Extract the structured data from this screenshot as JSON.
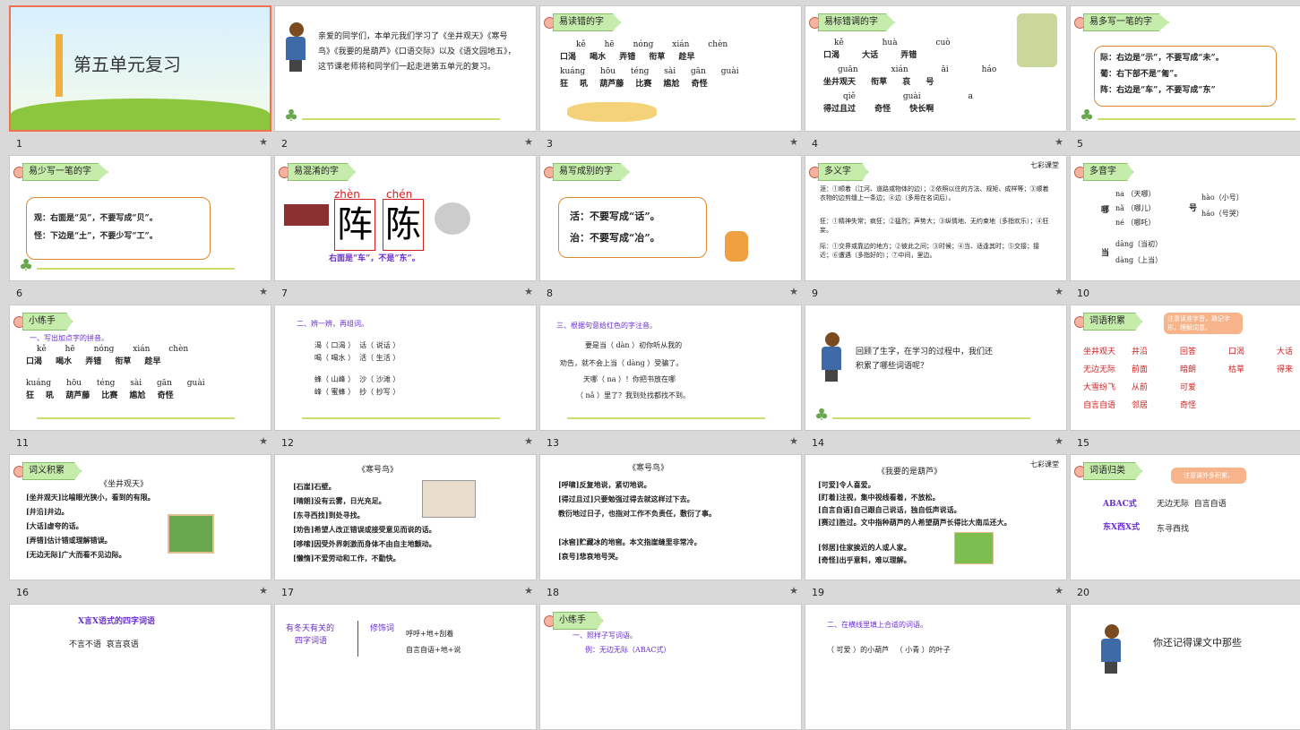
{
  "slides": [
    {
      "num": "1",
      "title": "第五单元复习"
    },
    {
      "num": "2",
      "text": "亲爱的同学们，本单元我们学习了《坐井观天》《寒号鸟》《我要的是葫芦》《口语交际》以及《语文园地五》，这节课老师将和同学们一起走进第五单元的复习。"
    },
    {
      "num": "3",
      "header": "易读错的字",
      "row1_py": "kě hē nóng xián chèn",
      "row1": "口渴 喝水 弄错 衔草 趁早",
      "row2_py": "kuáng hōu téng sài gān guài",
      "row2": "狂 吼 葫芦藤 比赛 尴尬 奇怪"
    },
    {
      "num": "4",
      "header": "易标错调的字",
      "row1_py": "kě huà cuò",
      "row1": "口渴 大话 弄错",
      "row2_py": "guān xián āi háo",
      "row2": "坐井观天 衔草 哀 号",
      "row3_py": "qiě guài a",
      "row3": "得过且过 奇怪 快长啊"
    },
    {
      "num": "5",
      "header": "易多写一笔的字",
      "l1": "际：右边是“示”，不要写成“未”。",
      "l2": "葡：右下部不是“匍”。",
      "l3": "阵：右边是“车”，不要写成“东”"
    },
    {
      "num": "6",
      "header": "易少写一笔的字",
      "l1": "观：右面是“见”，不要写成“贝”。",
      "l2": "怪：下边是“土”，不要少写“工”。"
    },
    {
      "num": "7",
      "header": "易混淆的字",
      "py1": "zhèn",
      "py2": "chén",
      "c1": "阵",
      "c2": "陈",
      "note": "右面是“车”，不是“东”。"
    },
    {
      "num": "8",
      "header": "易写成别的字",
      "l1": "活：不要写成“话”。",
      "l2": "治：不要写成“冶”。"
    },
    {
      "num": "9",
      "header": "多义字",
      "brand": "七彩课堂",
      "l1": "涯：①顺着（江河、道路或物体的边）；②依照以往的方法、规矩、成样等；③顺着衣物的边剪缝上一条边；④边（多用在名词后）。",
      "l2": "狂：①精神失常；疯狂；②猛烈；声势大；③纵情地、无约束地（多指欢乐）；④狂妄。",
      "l3": "际：①交界或靠边的地方；②彼此之间；③时候；④当、适逢其时；⑤交接；接近；⑥遭遇（多指好的）；⑦中间，里边。"
    },
    {
      "num": "10",
      "header": "多音字",
      "c1": "哪",
      "p1": "na （天哪）",
      "p2": "nǎ （哪儿）",
      "p3": "né （哪吒）",
      "c2": "号",
      "p4": "hào（小号）",
      "p5": "háo（号哭）",
      "c3": "当",
      "p6": "dāng（当初）",
      "p7": "dàng（上当）"
    },
    {
      "num": "11",
      "header": "小练手",
      "sub": "一、写出加点字的拼音。",
      "row1_py": "kě hē nóng xián chèn",
      "row1": "口渴 喝水 弄错 衔草 趁早",
      "row2_py": "kuáng hōu téng sài gān guài",
      "row2": "狂 吼 葫芦藤 比赛 尴尬 奇怪"
    },
    {
      "num": "12",
      "sub": "二、辨一辨，再组词。",
      "a": "渴（ 口渴 ）  话（ 说话 ）",
      "b": "喝（ 喝水 ）  活（ 生活 ）",
      "c": "蜂（ 山峰 ）  沙（ 沙滩 ）",
      "d": "峰（ 蜜蜂 ）  抄（ 抄写 ）"
    },
    {
      "num": "13",
      "sub": "三、根据句意给红色的字注音。",
      "a": "要是当（ dàn ）初你听从我的",
      "b": "劝告，就不会上当（ dàng ）受骗了。",
      "c": "天哪（ na ）！你把书放在哪",
      "d": "（ nǎ ）里了？我到处找都找不到。"
    },
    {
      "num": "14",
      "text": "回顾了生字，在学习的过程中，我们还积累了哪些词语呢？"
    },
    {
      "num": "15",
      "header": "词语积累",
      "note": "注意读准字音，熟记字形，理解词意。",
      "words": [
        "坐井观天",
        "井沿",
        "回答",
        "口渴",
        "大话",
        "无边无际",
        "前面",
        "暗朗",
        "枯草",
        "得来",
        "大雪纷飞",
        "从前",
        "可爱",
        "自言自语",
        "邻居",
        "奇怪"
      ]
    },
    {
      "num": "16",
      "header": "词义积累",
      "title": "《坐井观天》",
      "l1": "[坐井观天]比喻眼光狭小，看到的有限。",
      "l2": "[井沿]井边。",
      "l3": "[大话]虚夸的话。",
      "l4": "[弄错]估计错或理解错误。",
      "l5": "[无边无际]广大而看不见边际。"
    },
    {
      "num": "17",
      "title": "《寒号鸟》",
      "l1": "[石崖]石壁。",
      "l2": "[晴朗]没有云雾，日光充足。",
      "l3": "[东寻西找]到处寻找。",
      "l4": "[劝告]希望人改正错误或接受意见而说的话。",
      "l5": "[哆嗦]因受外界刺激而身体不由自主地颤动。",
      "l6": "[懒惰]不爱劳动和工作，不勤快。"
    },
    {
      "num": "18",
      "title": "《寒号鸟》",
      "l1": "[呼啸]反复地说，紧切地说。",
      "l2": "[得过且过]只要勉强过得去就这样过下去。",
      "l3": "教衍地过日子，也指对工作不负责任，敷衍了事。",
      "l4": "[冰窖]贮藏冰的地窖。本文指崖缝里非常冷。",
      "l5": "[哀号]悲哀地号哭。"
    },
    {
      "num": "19",
      "title": "《我要的是葫芦》",
      "brand": "七彩课堂",
      "l1": "[可爱]令人喜爱。",
      "l2": "[盯着]注视，集中视线看着，不放松。",
      "l3": "[自言自语]自己跟自己说话，独自低声说话。",
      "l4": "[赛过]胜过。文中指种葫芦的人希望葫芦长得比大南瓜还大。",
      "l5": "[邻居]住家挨近的人或人家。",
      "l6": "[奇怪]出乎意料，难以理解。"
    },
    {
      "num": "20",
      "header": "词语归类",
      "note": "注意课外多积累。",
      "k1": "ABAC式",
      "v1": "无边无际  自言自语",
      "k2": "东X西X式",
      "v2": "东寻西找"
    },
    {
      "num": "21",
      "title": "X言X语式的四字词语",
      "l1": "不言不语  哀言哀语"
    },
    {
      "num": "22",
      "t1": "有冬天有关的",
      "t2": "四字词语",
      "m": "修饰词",
      "r1": "呼呼+地+刮着",
      "r2": "自言自语+地+说"
    },
    {
      "num": "23",
      "header": "小练手",
      "sub": "一、照样子写词语。",
      "l1": "例：无边无际（ABAC式）"
    },
    {
      "num": "24",
      "sub": "二、在横线里填上合适的词语。",
      "l1": "（ 可爱 ）的小葫芦   （ 小青 ）的叶子"
    },
    {
      "num": "25",
      "text": "你还记得课文中那些"
    }
  ],
  "colors": {
    "accent": "#d12020",
    "header_bg": "#c6ecab",
    "selected_border": "#f07050",
    "box_border": "#e08a30",
    "purple": "#6a2fd0"
  }
}
